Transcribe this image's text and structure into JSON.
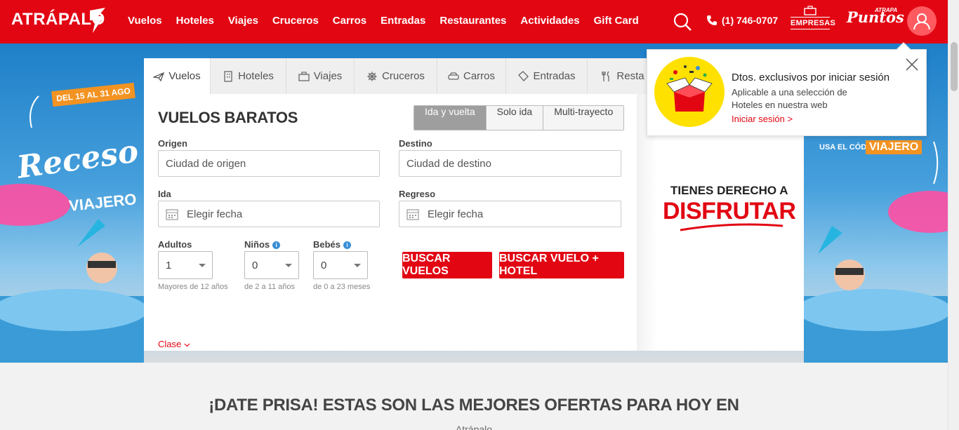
{
  "colors": {
    "brand_red": "#e20613",
    "accent_orange": "#f39322",
    "info_blue": "#3a8fd6"
  },
  "header": {
    "logo": "ATRÁPALO",
    "nav": [
      "Vuelos",
      "Hoteles",
      "Viajes",
      "Cruceros",
      "Carros",
      "Entradas",
      "Restaurantes",
      "Actividades",
      "Gift Card"
    ],
    "phone": "(1) 746-0707",
    "empresas": "EMPRESAS",
    "puntos_brand": "Puntos",
    "puntos_small": "ATRAPA",
    "icons": {
      "search": "search-icon",
      "phone": "phone-icon",
      "user": "user-icon",
      "empresas": "briefcase-icon"
    }
  },
  "hero": {
    "left": {
      "date_badge": "DEL 15 AL 31 AGO",
      "title": "Receso",
      "subtitle": "VIAJERO"
    },
    "right": {
      "code_label": "USA EL CÓDIGO",
      "code": "VIAJERO"
    }
  },
  "tabs": [
    {
      "label": "Vuelos",
      "icon": "plane-icon",
      "active": true
    },
    {
      "label": "Hoteles",
      "icon": "building-icon",
      "active": false
    },
    {
      "label": "Viajes",
      "icon": "suitcase-icon",
      "active": false
    },
    {
      "label": "Cruceros",
      "icon": "helm-icon",
      "active": false
    },
    {
      "label": "Carros",
      "icon": "car-icon",
      "active": false
    },
    {
      "label": "Entradas",
      "icon": "ticket-icon",
      "active": false
    },
    {
      "label": "Resta",
      "icon": "fork-knife-icon",
      "active": false
    }
  ],
  "search": {
    "title": "VUELOS BARATOS",
    "trip_types": [
      "Ida y vuelta",
      "Solo ida",
      "Multi-trayecto"
    ],
    "selected_trip_type": "Ida y vuelta",
    "origen_label": "Origen",
    "origen_placeholder": "Ciudad de origen",
    "destino_label": "Destino",
    "destino_placeholder": "Ciudad de destino",
    "ida_label": "Ida",
    "ida_placeholder": "Elegir fecha",
    "regreso_label": "Regreso",
    "regreso_placeholder": "Elegir fecha",
    "adultos_label": "Adultos",
    "adultos_value": "1",
    "adultos_hint": "Mayores de 12 años",
    "ninos_label": "Niños",
    "ninos_value": "0",
    "ninos_hint": "de 2 a 11 años",
    "bebes_label": "Bebés",
    "bebes_value": "0",
    "bebes_hint": "de 0 a 23 meses",
    "clase_label": "Clase",
    "btn_vuelos": "BUSCAR VUELOS",
    "btn_vuelo_hotel": "BUSCAR VUELO + HOTEL"
  },
  "promo": {
    "line1": "TIENES DERECHO A",
    "line2": "DISFRUTAR"
  },
  "popover": {
    "title": "Dtos. exclusivos por iniciar sesión",
    "description": "Aplicable a una selección de Hoteles en nuestra web",
    "link": "Iniciar sesión >"
  },
  "deals": {
    "title": "¡DATE PRISA! ESTAS SON LAS MEJORES OFERTAS PARA HOY EN",
    "subtitle": "Atrápalo"
  }
}
